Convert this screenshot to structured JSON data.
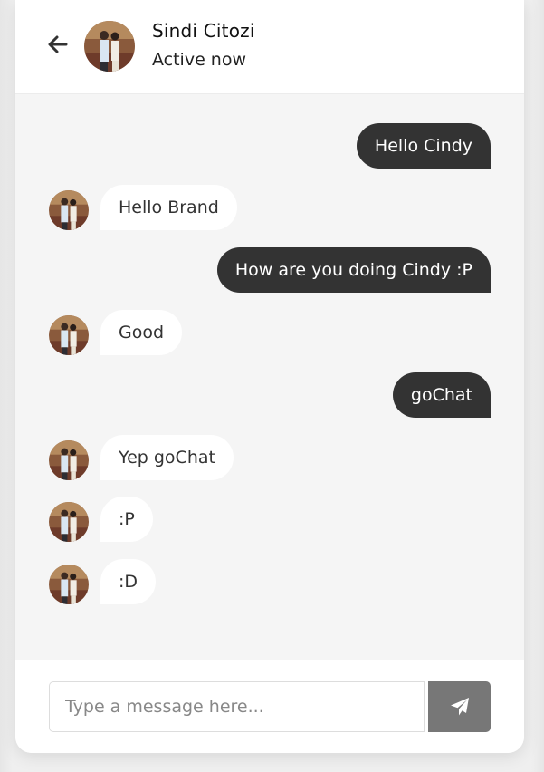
{
  "header": {
    "name": "Sindi Citozi",
    "status": "Active now",
    "back_icon": "arrow-left-icon"
  },
  "messages": [
    {
      "direction": "outgoing",
      "text": "Hello Cindy"
    },
    {
      "direction": "incoming",
      "text": "Hello Brand"
    },
    {
      "direction": "outgoing",
      "text": "How are you doing Cindy :P"
    },
    {
      "direction": "incoming",
      "text": "Good"
    },
    {
      "direction": "outgoing",
      "text": "goChat"
    },
    {
      "direction": "incoming",
      "text": "Yep goChat"
    },
    {
      "direction": "incoming",
      "text": ":P"
    },
    {
      "direction": "incoming",
      "text": ":D"
    }
  ],
  "composer": {
    "placeholder": "Type a message here...",
    "value": "",
    "send_icon": "paper-plane-icon"
  },
  "colors": {
    "outgoing_bubble": "#333333",
    "incoming_bubble": "#ffffff",
    "chat_background": "#f5f5f5",
    "send_button": "#777777"
  }
}
